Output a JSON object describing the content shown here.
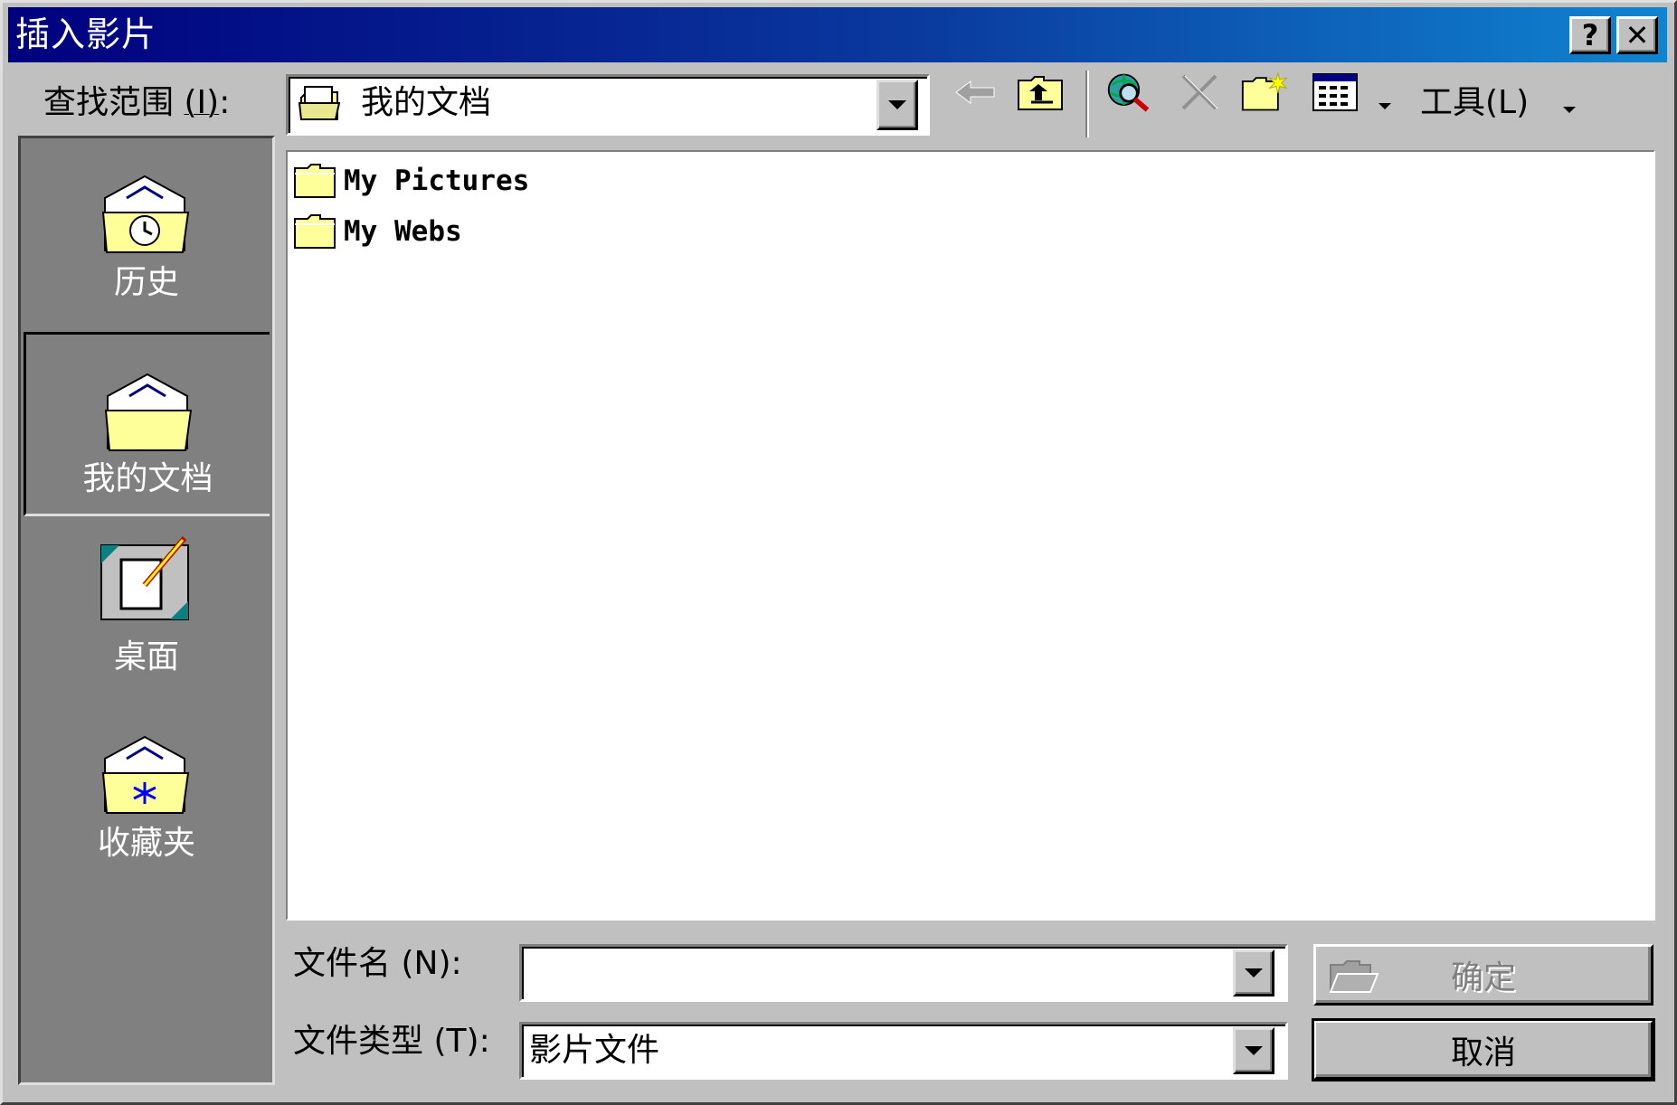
{
  "window": {
    "title": "插入影片",
    "help_label": "?",
    "close_label": "✕"
  },
  "toolbar": {
    "look_in_label": "查找范围",
    "look_in_hotkey": "(I)",
    "look_in_colon": ":",
    "look_in_value": "我的文档",
    "look_in_icon": "my-documents-icon",
    "tools_label": "工具",
    "tools_hotkey": "(L)"
  },
  "places": [
    {
      "label": "历史",
      "icon": "history-folder-icon"
    },
    {
      "label": "我的文档",
      "icon": "my-documents-folder-icon",
      "selected": true
    },
    {
      "label": "桌面",
      "icon": "desktop-icon"
    },
    {
      "label": "收藏夹",
      "icon": "favorites-folder-icon"
    }
  ],
  "files": [
    {
      "name": "My Pictures",
      "icon": "folder-icon"
    },
    {
      "name": "My Webs",
      "icon": "folder-icon"
    }
  ],
  "form": {
    "filename_label": "文件名",
    "filename_hotkey": "(N)",
    "filename_colon": ":",
    "filename_value": "",
    "filetype_label": "文件类型",
    "filetype_hotkey": "(T)",
    "filetype_colon": ":",
    "filetype_value": "影片文件"
  },
  "buttons": {
    "ok": "确定",
    "cancel": "取消"
  },
  "colors": {
    "title_start": "#00007e",
    "title_end": "#1084d0",
    "face": "#c0c0c0",
    "places_bg": "#808080",
    "folder": "#ffff99"
  }
}
